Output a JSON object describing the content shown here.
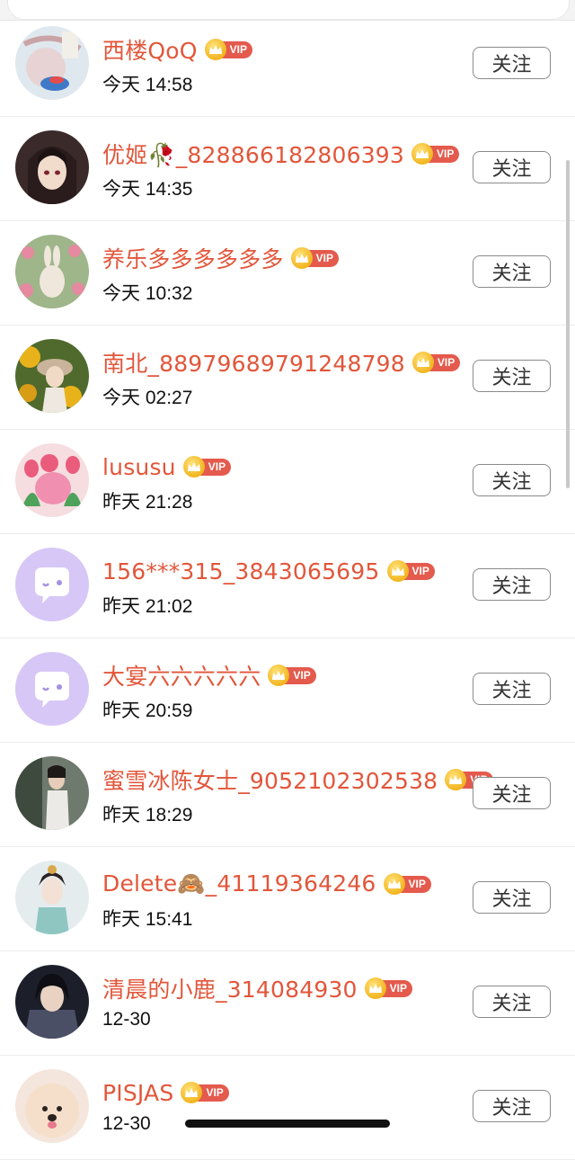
{
  "follow_label": "关注",
  "vip_label": "VIP",
  "colors": {
    "name": "#e2563a",
    "vip_tag": "#e45a4d",
    "crown": "#f2b51f"
  },
  "items": [
    {
      "name": "西楼QoQ",
      "time": "今天 14:58",
      "avatar": "landscape-art-avatar"
    },
    {
      "name": "优姬🥀_828866182806393",
      "time": "今天 14:35",
      "avatar": "anime-girl-avatar"
    },
    {
      "name": "养乐多多多多多多",
      "time": "今天 10:32",
      "avatar": "bunny-flowers-avatar"
    },
    {
      "name": "南北_88979689791248798",
      "time": "今天 02:27",
      "avatar": "sunflower-girl-avatar"
    },
    {
      "name": "lususu",
      "time": "昨天 21:28",
      "avatar": "pink-tulip-avatar"
    },
    {
      "name": "156***315_3843065695",
      "time": "昨天 21:02",
      "avatar": "default-chat-avatar"
    },
    {
      "name": "大宴六六六六六",
      "time": "昨天 20:59",
      "avatar": "default-chat-avatar"
    },
    {
      "name": "蜜雪冰陈女士_9052102302538",
      "time": "昨天 18:29",
      "avatar": "street-photo-avatar"
    },
    {
      "name": "Delete🙈_41119364246",
      "time": "昨天 15:41",
      "avatar": "hanfu-girl-avatar"
    },
    {
      "name": "清晨的小鹿_314084930",
      "time": "12-30",
      "avatar": "game-character-avatar"
    },
    {
      "name": "PISJAS",
      "time": "12-30",
      "avatar": "fluffy-dog-avatar"
    }
  ]
}
